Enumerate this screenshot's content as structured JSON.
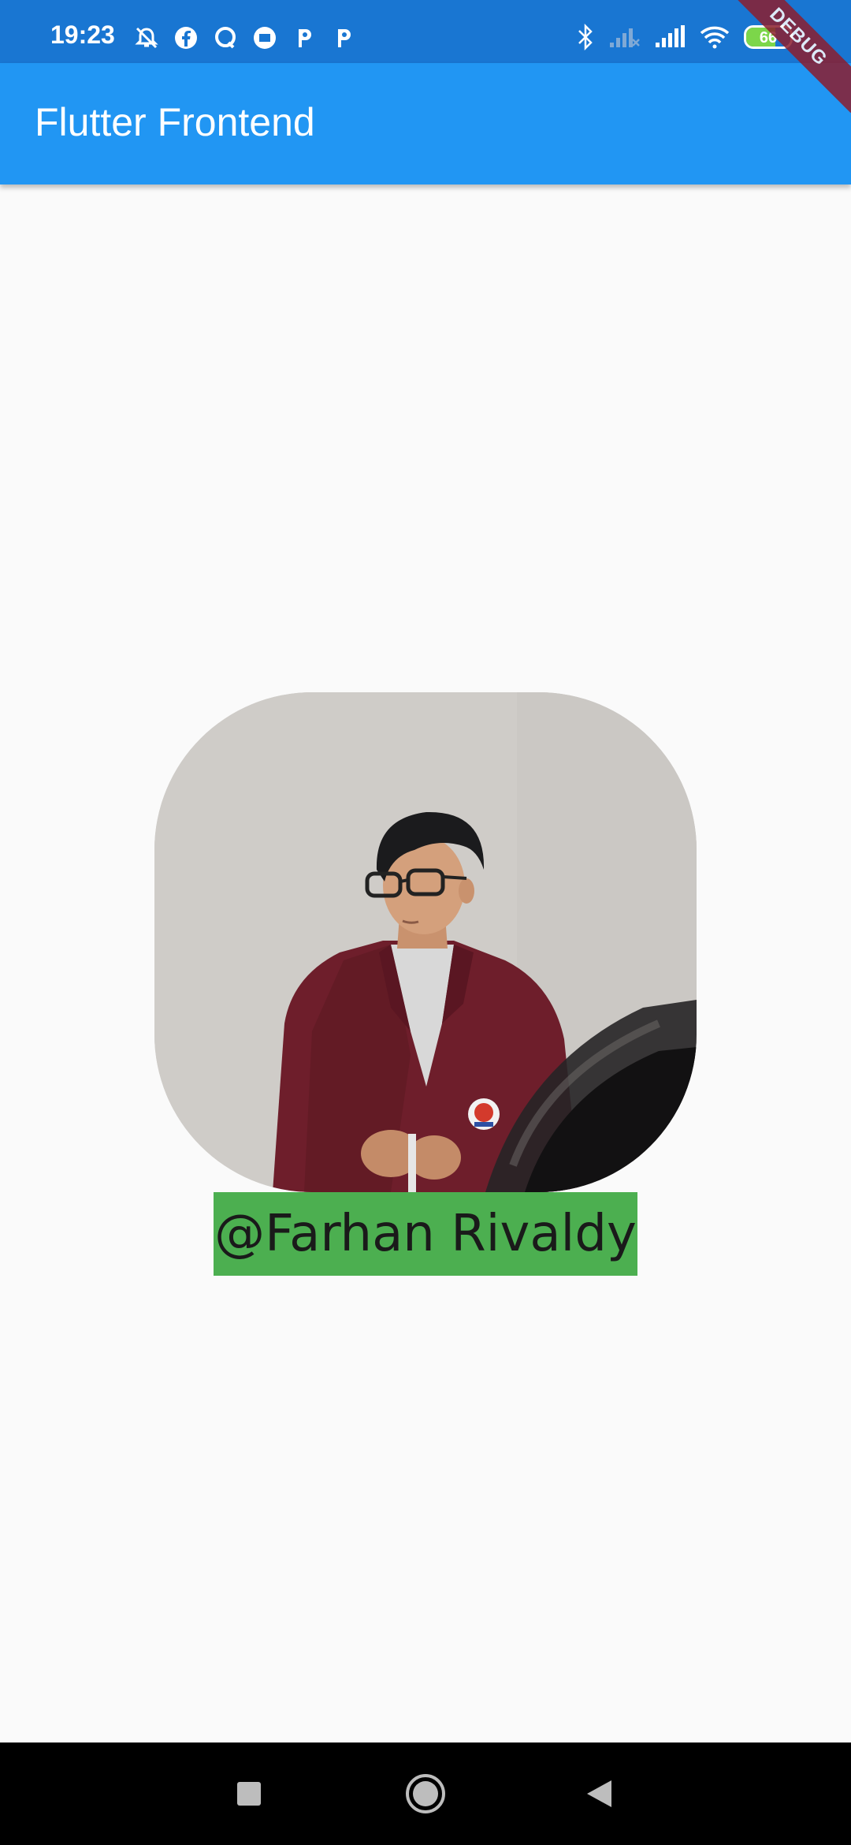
{
  "status_bar": {
    "time": "19:23",
    "battery_level": "66",
    "battery_fraction": 0.66,
    "left_icons": [
      "alarm-off-icon",
      "facebook-icon",
      "q-app-icon",
      "messenger-icon",
      "p-app-icon",
      "p-app-icon"
    ],
    "right_icons": [
      "bluetooth-icon",
      "signal-off-icon",
      "signal-icon",
      "wifi-icon",
      "battery-icon"
    ]
  },
  "app_bar": {
    "title": "Flutter Frontend"
  },
  "debug_banner": {
    "label": "DEBUG"
  },
  "profile": {
    "name_label": "@Farhan Rivaldy"
  },
  "nav_bar": {
    "buttons": [
      "recents-icon",
      "home-icon",
      "back-icon"
    ]
  },
  "colors": {
    "status_bar": "#1976D2",
    "app_bar": "#2196F3",
    "background": "#FAFAFA",
    "name_label_bg": "#4CAF50",
    "nav_bar": "#000000"
  }
}
